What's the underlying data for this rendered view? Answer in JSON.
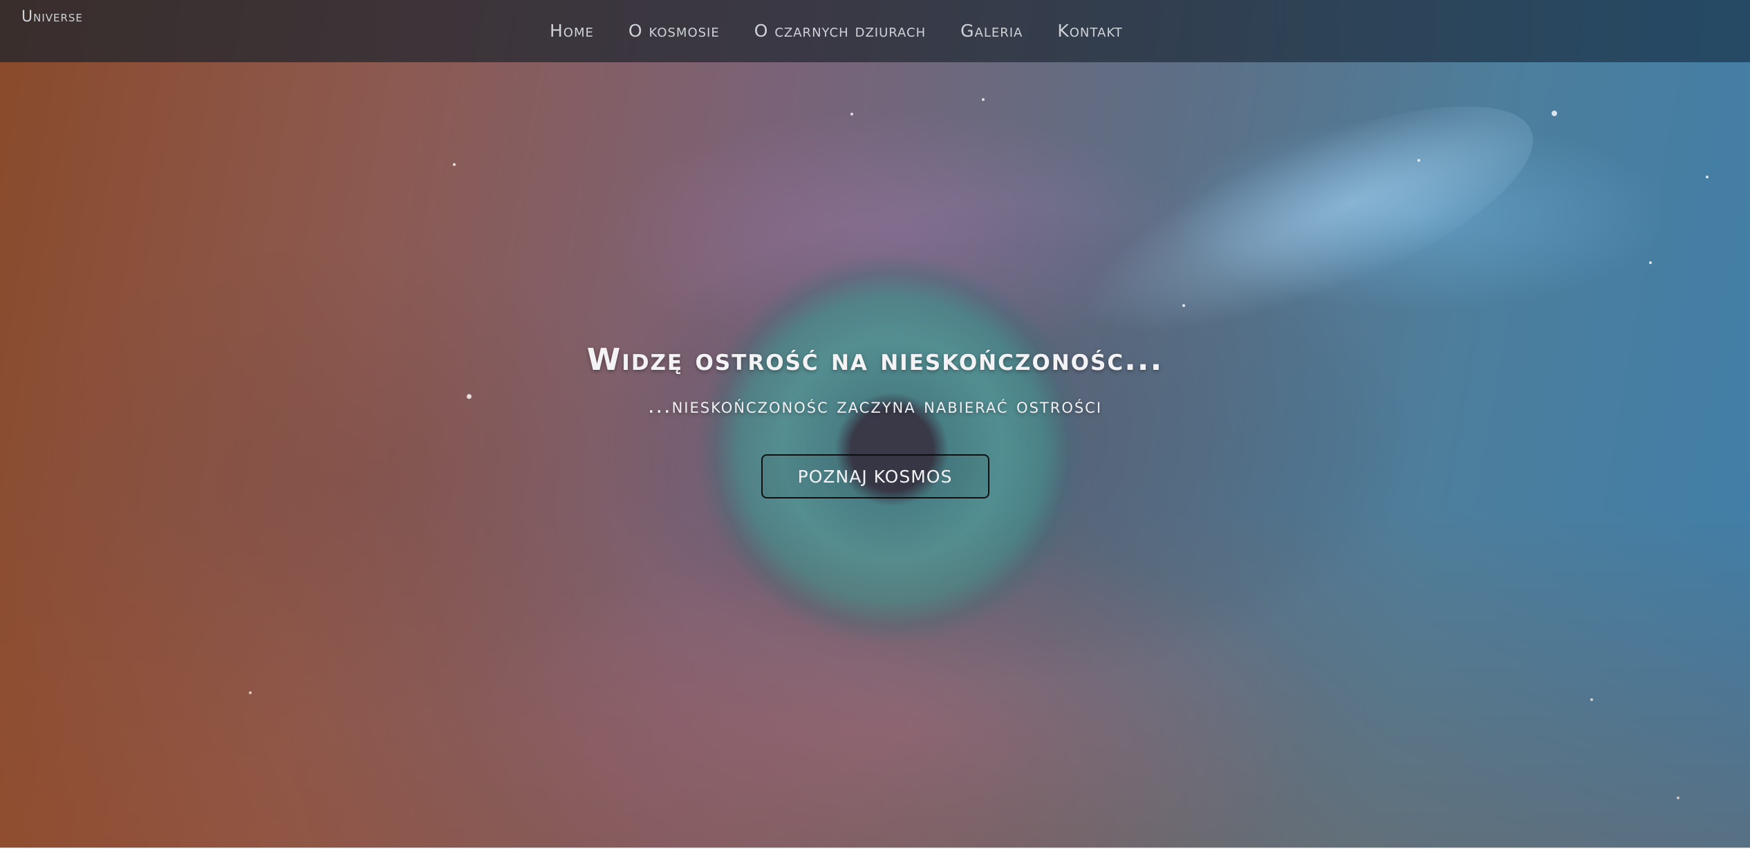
{
  "nav": {
    "brand": "Universe",
    "items": [
      {
        "label": "Home"
      },
      {
        "label": "O kosmosie"
      },
      {
        "label": "O czarnych dziurach"
      },
      {
        "label": "Galeria"
      },
      {
        "label": "Kontakt"
      }
    ]
  },
  "hero": {
    "title": "Widzę ostrość na nieskończonośc...",
    "subtitle": "...nieskończonośc zaczyna nabierać ostrości",
    "cta_label": "POZNAJ KOSMOS",
    "background_image": "eye-in-nebula"
  },
  "colors": {
    "nav_text": "#cfd3d8",
    "hero_text": "#f3f3f6",
    "button_border": "#0e0e10"
  }
}
